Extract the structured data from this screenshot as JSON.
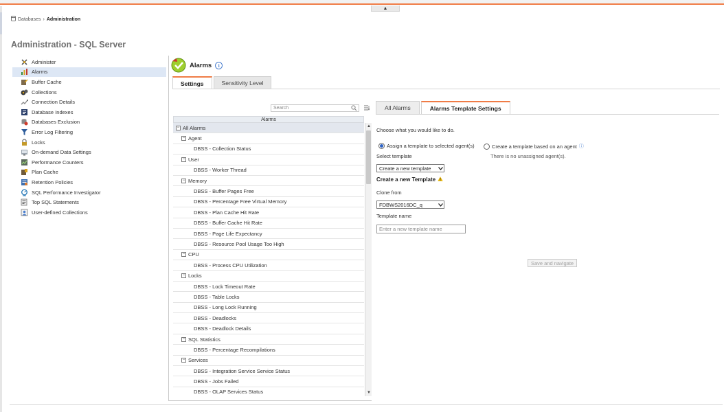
{
  "breadcrumb": {
    "items": [
      "Databases",
      "Administration"
    ]
  },
  "page_title": "Administration - SQL Server",
  "sidebar": {
    "items": [
      {
        "label": "Administer",
        "icon": "administer-icon"
      },
      {
        "label": "Alarms",
        "icon": "alarms-icon",
        "active": true
      },
      {
        "label": "Buffer Cache",
        "icon": "buffer-cache-icon"
      },
      {
        "label": "Collections",
        "icon": "collections-icon"
      },
      {
        "label": "Connection Details",
        "icon": "connection-details-icon"
      },
      {
        "label": "Database Indexes",
        "icon": "database-indexes-icon"
      },
      {
        "label": "Databases Exclusion",
        "icon": "databases-exclusion-icon"
      },
      {
        "label": "Error Log Filtering",
        "icon": "error-log-filtering-icon"
      },
      {
        "label": "Locks",
        "icon": "locks-icon"
      },
      {
        "label": "On-demand Data Settings",
        "icon": "on-demand-data-icon"
      },
      {
        "label": "Performance Counters",
        "icon": "performance-counters-icon"
      },
      {
        "label": "Plan Cache",
        "icon": "plan-cache-icon"
      },
      {
        "label": "Retention Policies",
        "icon": "retention-policies-icon"
      },
      {
        "label": "SQL Performance Investigator",
        "icon": "sql-performance-investigator-icon"
      },
      {
        "label": "Top SQL Statements",
        "icon": "top-sql-statements-icon"
      },
      {
        "label": "User-defined Collections",
        "icon": "user-defined-collections-icon"
      }
    ]
  },
  "alarms": {
    "title": "Alarms",
    "tabs": [
      "Settings",
      "Sensitivity Level"
    ],
    "active_tab": 0
  },
  "alarm_list": {
    "search_placeholder": "Search",
    "column_header": "Alarms",
    "root_label": "All Alarms",
    "rows": [
      {
        "kind": "group",
        "label": "Agent"
      },
      {
        "kind": "leaf",
        "label": "DBSS - Collection Status"
      },
      {
        "kind": "group",
        "label": "User"
      },
      {
        "kind": "leaf",
        "label": "DBSS - Worker Thread"
      },
      {
        "kind": "group",
        "label": "Memory"
      },
      {
        "kind": "leaf",
        "label": "DBSS - Buffer Pages Free"
      },
      {
        "kind": "leaf",
        "label": "DBSS - Percentage Free Virtual Memory"
      },
      {
        "kind": "leaf",
        "label": "DBSS - Plan Cache Hit Rate"
      },
      {
        "kind": "leaf",
        "label": "DBSS - Buffer Cache Hit Rate"
      },
      {
        "kind": "leaf",
        "label": "DBSS - Page Life Expectancy"
      },
      {
        "kind": "leaf",
        "label": "DBSS - Resource Pool Usage Too High"
      },
      {
        "kind": "group",
        "label": "CPU"
      },
      {
        "kind": "leaf",
        "label": "DBSS - Process CPU Utilization"
      },
      {
        "kind": "group",
        "label": "Locks"
      },
      {
        "kind": "leaf",
        "label": "DBSS - Lock Timeout Rate"
      },
      {
        "kind": "leaf",
        "label": "DBSS - Table Locks"
      },
      {
        "kind": "leaf",
        "label": "DBSS - Long Lock Running"
      },
      {
        "kind": "leaf",
        "label": "DBSS - Deadlocks"
      },
      {
        "kind": "leaf",
        "label": "DBSS - Deadlock Details"
      },
      {
        "kind": "group",
        "label": "SQL Statistics"
      },
      {
        "kind": "leaf",
        "label": "DBSS - Percentage Recompilations"
      },
      {
        "kind": "group",
        "label": "Services"
      },
      {
        "kind": "leaf",
        "label": "DBSS - Integration Service Service Status"
      },
      {
        "kind": "leaf",
        "label": "DBSS - Jobs Failed"
      },
      {
        "kind": "leaf",
        "label": "DBSS - OLAP Services Status"
      }
    ]
  },
  "template_settings": {
    "tabs": [
      "All Alarms",
      "Alarms Template Settings"
    ],
    "active_tab": 1,
    "prompt": "Choose what you would like to do.",
    "option_assign": "Assign a template to selected agent(s)",
    "option_create": "Create a template based on an agent",
    "no_agents_note": "There is no unassigned agent(s).",
    "select_template_label": "Select template",
    "select_template_value": "Create a new template",
    "create_new_heading": "Create a new Template",
    "clone_from_label": "Clone from",
    "clone_from_value": "FDBWS2016DC_q",
    "template_name_label": "Template name",
    "template_name_placeholder": "Enter a new template name",
    "save_button": "Save and navigate"
  },
  "colors": {
    "accent_orange": "#f07c46",
    "active_item_bg": "#dde7f5",
    "info_blue": "#4a7fcf",
    "warning_yellow": "#e8b400"
  }
}
